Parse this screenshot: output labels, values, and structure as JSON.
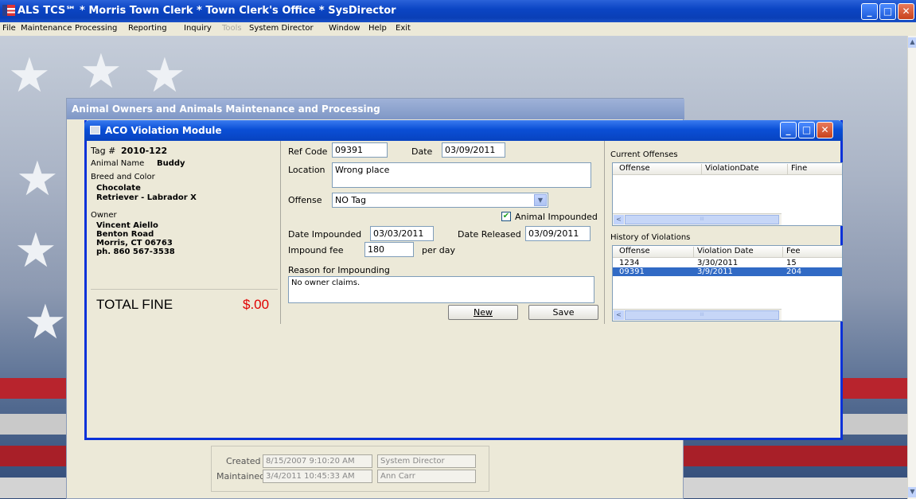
{
  "app": {
    "title": "ALS TCS℠ * Morris Town Clerk * Town Clerk's Office * SysDirector",
    "min": "_",
    "max": "□",
    "close": "✕"
  },
  "menu": [
    "File",
    "Maintenance",
    "Processing",
    "Reporting",
    "Inquiry",
    "Tools",
    "System Director",
    "Window",
    "Help",
    "Exit"
  ],
  "owner_window": {
    "title": "Animal Owners and Animals Maintenance and Processing",
    "created_label": "Created",
    "created_value": "8/15/2007 9:10:20 AM",
    "created_by": "System Director",
    "maintained_label": "Maintained",
    "maintained_value": "3/4/2011 10:45:33 AM",
    "maintained_by": "Ann Carr"
  },
  "aco": {
    "title": "ACO Violation Module",
    "tag_label": "Tag #",
    "tag_value": "2010-122",
    "animal_name_label": "Animal Name",
    "animal_name_value": "Buddy",
    "breed_label": "Breed and Color",
    "breed_line1": "Chocolate",
    "breed_line2": "Retriever - Labrador X",
    "owner_label": "Owner",
    "owner_name": "Vincent Aiello",
    "owner_street": "Benton Road",
    "owner_city": "Morris, CT 06763",
    "owner_phone": "ph. 860 567-3538",
    "total_fine_label": "TOTAL FINE",
    "total_fine_value": "$.00",
    "ref_code_label": "Ref Code",
    "ref_code_value": "09391",
    "date_label": "Date",
    "date_value": "03/09/2011",
    "location_label": "Location",
    "location_value": "Wrong place",
    "offense_label": "Offense",
    "offense_value": "NO Tag",
    "impounded_label": "Animal Impounded",
    "impounded_checked": "✔",
    "date_impounded_label": "Date Impounded",
    "date_impounded_value": "03/03/2011",
    "date_released_label": "Date Released",
    "date_released_value": "03/09/2011",
    "impound_fee_label": "Impound fee",
    "impound_fee_value": "180",
    "per_day_label": "per day",
    "reason_label": "Reason for Impounding",
    "reason_value": "No owner claims.",
    "new_button": "New",
    "save_button": "Save",
    "current_offenses": {
      "label": "Current Offenses",
      "columns": [
        "Offense",
        "ViolationDate",
        "Fine"
      ]
    },
    "history": {
      "label": "History of Violations",
      "columns": [
        "Offense",
        "Violation Date",
        "Fee"
      ],
      "rows": [
        {
          "offense": "1234",
          "date": "3/30/2011",
          "fee": "15"
        },
        {
          "offense": "09391",
          "date": "3/9/2011",
          "fee": "204"
        }
      ]
    },
    "scroll_left": "<",
    "scroll_grip": "III"
  },
  "colors": {
    "titlebar": "#0a3fb6",
    "total_fine": "#e00000",
    "selection": "#316ac5"
  }
}
